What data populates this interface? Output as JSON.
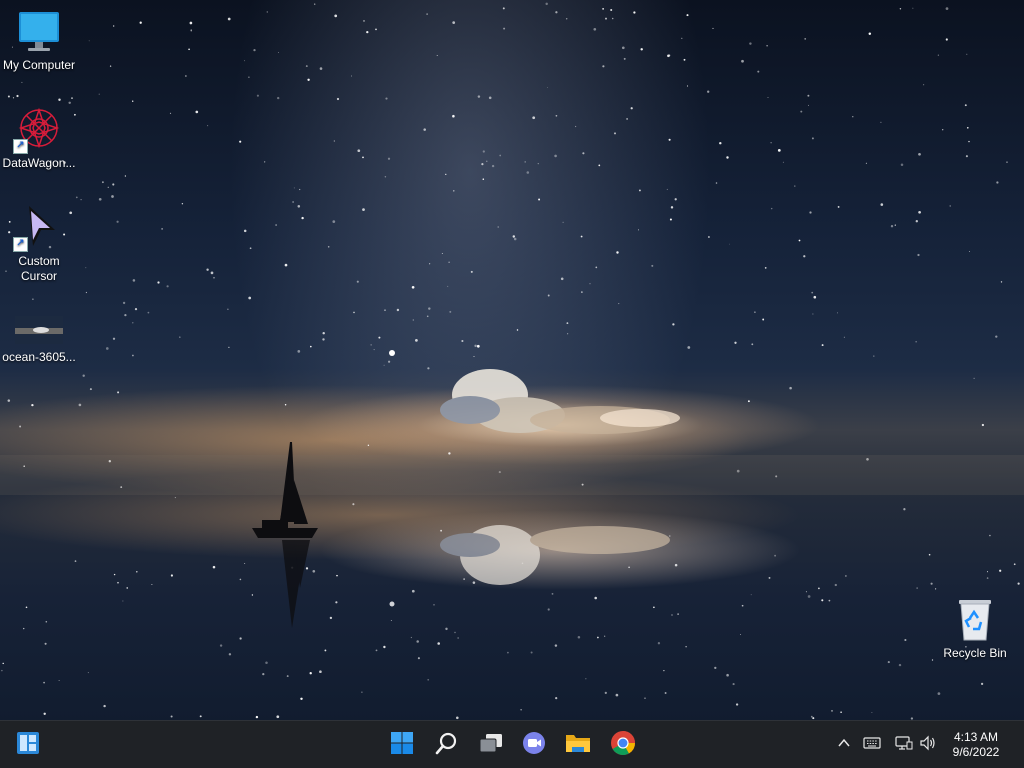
{
  "desktop": {
    "icons": [
      {
        "name": "My Computer",
        "icon": "monitor-icon",
        "shortcut": false
      },
      {
        "name": "DataWagon...",
        "icon": "datawagon-icon",
        "shortcut": true
      },
      {
        "name": "Custom Cursor",
        "icon": "cursor-icon",
        "shortcut": true
      },
      {
        "name": "ocean-3605...",
        "icon": "image-thumbnail-icon",
        "shortcut": false
      },
      {
        "name": "Recycle Bin",
        "icon": "recycle-bin-icon",
        "shortcut": false
      }
    ]
  },
  "taskbar": {
    "left": {
      "icon": "widgets-icon"
    },
    "center": [
      {
        "app": "Start",
        "icon": "windows-start-icon"
      },
      {
        "app": "Search",
        "icon": "search-icon"
      },
      {
        "app": "Task View",
        "icon": "task-view-icon"
      },
      {
        "app": "Chat",
        "icon": "teams-chat-icon"
      },
      {
        "app": "File Explorer",
        "icon": "folder-icon"
      },
      {
        "app": "Google Chrome",
        "icon": "chrome-icon"
      }
    ],
    "tray": {
      "icons": [
        "chevron-up-icon",
        "keyboard-icon",
        "network-icon",
        "speaker-icon"
      ],
      "time": "4:13 AM",
      "date": "9/6/2022"
    }
  },
  "colors": {
    "taskbar_bg": "#1f2226",
    "accent_blue": "#0a84ff",
    "recycle_blue": "#1e90ff"
  }
}
